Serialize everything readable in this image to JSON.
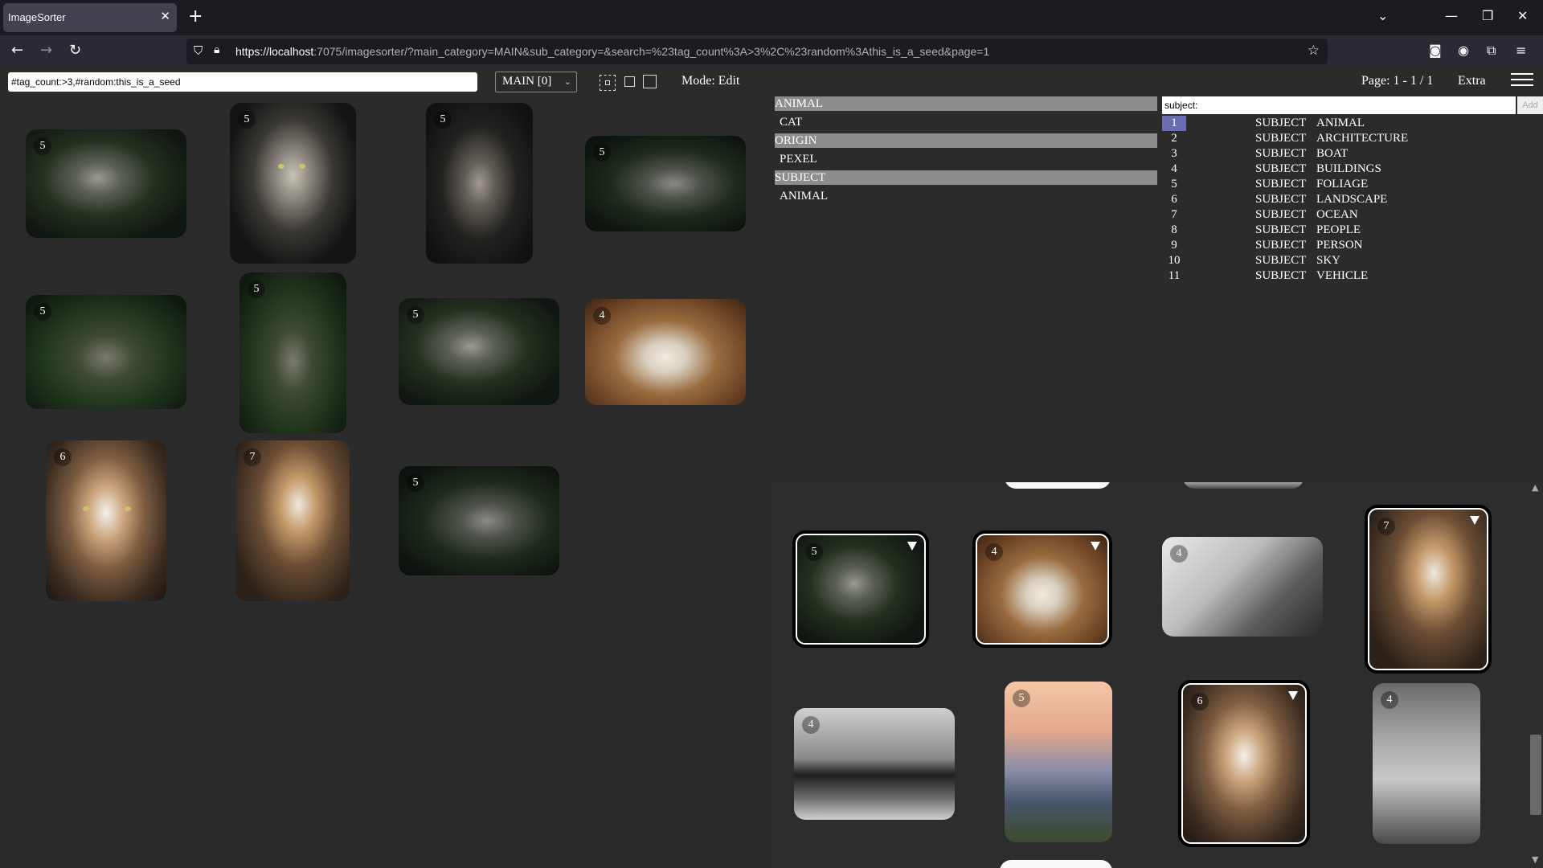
{
  "browser": {
    "tab_title": "ImageSorter",
    "url_host": "https://localhost",
    "url_rest": ":7075/imagesorter/?main_category=MAIN&sub_category=&search=%23tag_count%3A>3%2C%23random%3Athis_is_a_seed&page=1"
  },
  "toolbar": {
    "search_value": "#tag_count:>3,#random:this_is_a_seed",
    "category_select": "MAIN [0]",
    "mode_label": "Mode: Edit",
    "page_label": "Page: 1 - 1 / 1",
    "extra_label": "Extra"
  },
  "gallery": {
    "thumbs": [
      {
        "badge": "5"
      },
      {
        "badge": "5"
      },
      {
        "badge": "5"
      },
      {
        "badge": "5"
      },
      {
        "badge": "5"
      },
      {
        "badge": "5"
      },
      {
        "badge": "5"
      },
      {
        "badge": "4"
      },
      {
        "badge": "6"
      },
      {
        "badge": "7"
      },
      {
        "badge": "5"
      }
    ]
  },
  "tagtree": {
    "rows": [
      {
        "type": "cat",
        "label": "ANIMAL"
      },
      {
        "type": "item",
        "label": "CAT"
      },
      {
        "type": "cat",
        "label": "ORIGIN"
      },
      {
        "type": "item",
        "label": "PEXEL"
      },
      {
        "type": "cat",
        "label": "SUBJECT"
      },
      {
        "type": "item",
        "label": "ANIMAL"
      }
    ]
  },
  "subject_panel": {
    "input_value": "subject:",
    "add_label": "Add",
    "rows": [
      {
        "num": "1",
        "cat": "SUBJECT",
        "val": "ANIMAL"
      },
      {
        "num": "2",
        "cat": "SUBJECT",
        "val": "ARCHITECTURE"
      },
      {
        "num": "3",
        "cat": "SUBJECT",
        "val": "BOAT"
      },
      {
        "num": "4",
        "cat": "SUBJECT",
        "val": "BUILDINGS"
      },
      {
        "num": "5",
        "cat": "SUBJECT",
        "val": "FOLIAGE"
      },
      {
        "num": "6",
        "cat": "SUBJECT",
        "val": "LANDSCAPE"
      },
      {
        "num": "7",
        "cat": "SUBJECT",
        "val": "OCEAN"
      },
      {
        "num": "8",
        "cat": "SUBJECT",
        "val": "PEOPLE"
      },
      {
        "num": "9",
        "cat": "SUBJECT",
        "val": "PERSON"
      },
      {
        "num": "10",
        "cat": "SUBJECT",
        "val": "SKY"
      },
      {
        "num": "11",
        "cat": "SUBJECT",
        "val": "VEHICLE"
      }
    ]
  },
  "right_gallery": {
    "thumbs": [
      {
        "badge": "5"
      },
      {
        "badge": "4"
      },
      {
        "badge": "4"
      },
      {
        "badge": "7"
      },
      {
        "badge": "4"
      },
      {
        "badge": "5"
      },
      {
        "badge": "6"
      },
      {
        "badge": "4"
      }
    ]
  },
  "icons": {
    "tab_close": "close-icon",
    "new_tab": "plus-icon",
    "back": "back-arrow-icon",
    "forward": "forward-arrow-icon",
    "reload": "reload-icon",
    "bookmark": "star-icon"
  }
}
